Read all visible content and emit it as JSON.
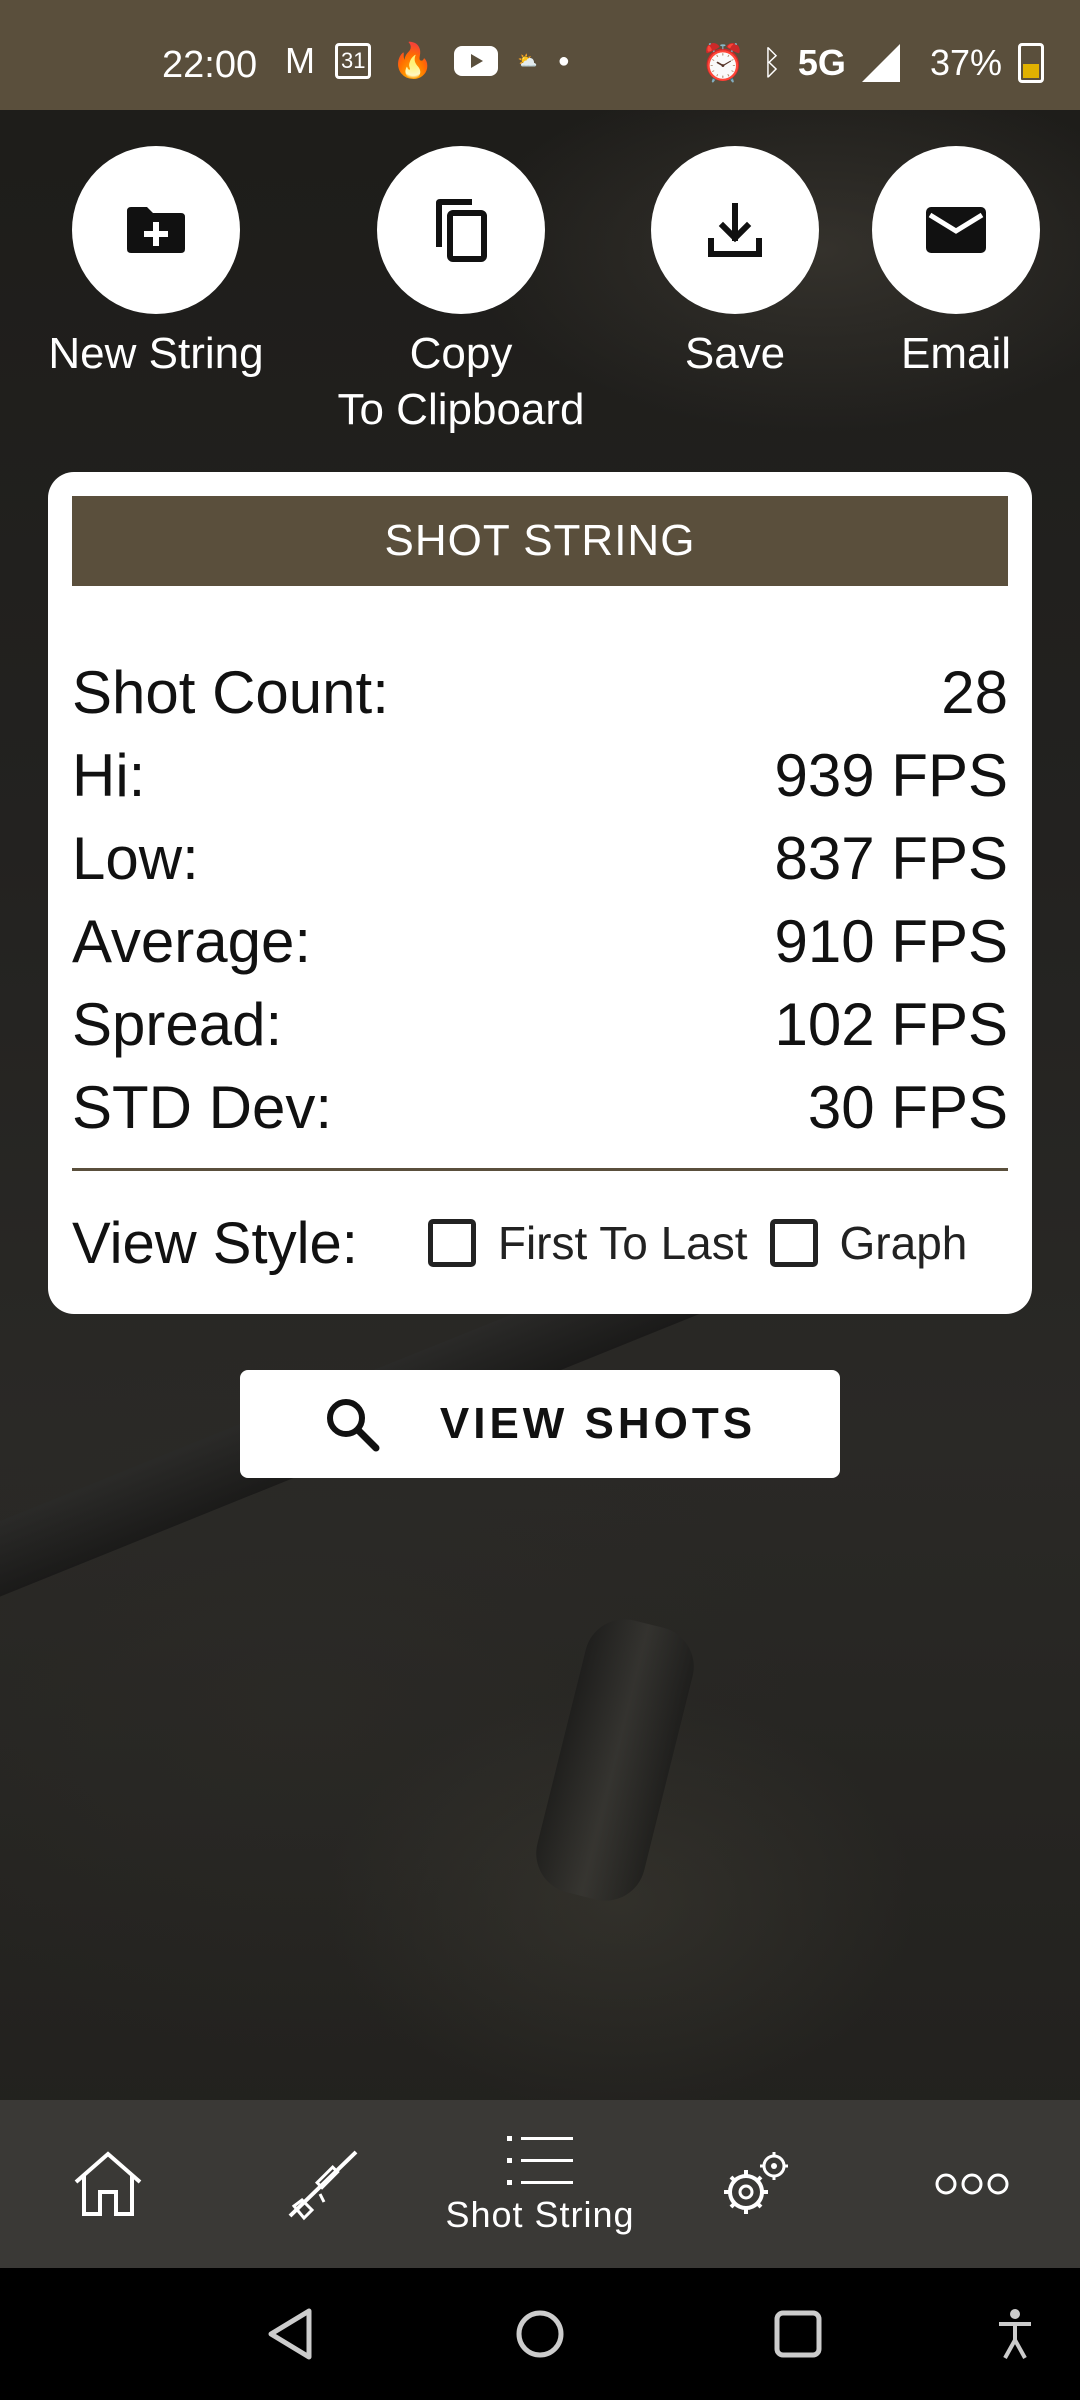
{
  "status_bar": {
    "time": "22:00",
    "network": "5G",
    "battery": "37%",
    "icons": [
      "gmail-icon",
      "calendar-icon",
      "flame-icon",
      "youtube-icon",
      "weather-icon",
      "dot-icon",
      "alarm-icon",
      "bluetooth-icon",
      "signal-icon",
      "battery-icon"
    ],
    "calendar_day": "31"
  },
  "actions": [
    {
      "label": "New String",
      "icon": "new-folder-icon"
    },
    {
      "label": "Copy\nTo Clipboard",
      "icon": "copy-icon"
    },
    {
      "label": "Save",
      "icon": "download-icon"
    },
    {
      "label": "Email",
      "icon": "mail-icon"
    }
  ],
  "action_labels": {
    "new_string": "New String",
    "copy_line1": "Copy",
    "copy_line2": "To Clipboard",
    "save": "Save",
    "email": "Email"
  },
  "card": {
    "title": "SHOT STRING",
    "stats": {
      "shot_count_label": "Shot Count:",
      "shot_count_value": "28",
      "hi_label": "Hi:",
      "hi_value": "939 FPS",
      "low_label": "Low:",
      "low_value": "837 FPS",
      "average_label": "Average:",
      "average_value": "910 FPS",
      "spread_label": "Spread:",
      "spread_value": "102 FPS",
      "std_label": "STD Dev:",
      "std_value": "30 FPS"
    },
    "view_style": {
      "label": "View Style:",
      "first_to_last": "First To Last",
      "graph": "Graph",
      "first_to_last_checked": false,
      "graph_checked": false
    }
  },
  "view_shots_button": "VIEW SHOTS",
  "bottom_nav": {
    "items": [
      "home-icon",
      "rifle-icon",
      "list-icon",
      "settings-icon",
      "more-icon"
    ],
    "active_label": "Shot String"
  },
  "colors": {
    "accent": "#5a4f3c",
    "nav_bg": "#3a3936",
    "card_bg": "#ffffff"
  }
}
